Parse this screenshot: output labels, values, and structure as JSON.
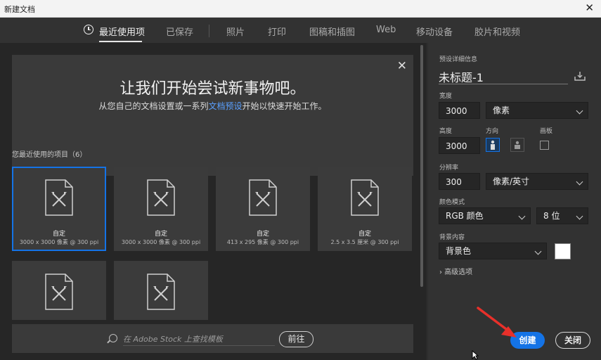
{
  "window": {
    "title": "新建文档",
    "close_glyph": "✕"
  },
  "tabs": [
    {
      "label": "最近使用项",
      "active": true,
      "icon": "clock-icon"
    },
    {
      "label": "已保存"
    },
    {
      "label": "照片"
    },
    {
      "label": "打印"
    },
    {
      "label": "图稿和插图"
    },
    {
      "label": "Web"
    },
    {
      "label": "移动设备"
    },
    {
      "label": "胶片和视频"
    }
  ],
  "banner": {
    "title": "让我们开始尝试新事物吧。",
    "subtitle_before": "从您自己的文档设置或一系列",
    "subtitle_link": "文档预设",
    "subtitle_after": "开始以快速开始工作。",
    "close_glyph": "✕"
  },
  "recent": {
    "label": "您最近使用的项目（6）",
    "items": [
      {
        "name": "自定",
        "size": "3000 x 3000 像素 @ 300 ppi"
      },
      {
        "name": "自定",
        "size": "3000 x 3000 像素 @ 300 ppi"
      },
      {
        "name": "自定",
        "size": "413 x 295 像素 @ 300 ppi"
      },
      {
        "name": "自定",
        "size": "2.5 x 3.5 厘米 @ 300 ppi"
      },
      {
        "name": "",
        "size": ""
      },
      {
        "name": "",
        "size": ""
      }
    ]
  },
  "search": {
    "placeholder": "在 Adobe Stock 上查找模板",
    "go_label": "前往"
  },
  "preset": {
    "section_label": "预设详细信息",
    "doc_name": "未标题-1",
    "width_label": "宽度",
    "width_value": "3000",
    "width_unit": "像素",
    "height_label": "高度",
    "height_value": "3000",
    "orientation_label": "方向",
    "artboard_label": "画板",
    "resolution_label": "分辨率",
    "resolution_value": "300",
    "resolution_unit": "像素/英寸",
    "color_mode_label": "颜色模式",
    "color_mode": "RGB 颜色",
    "bit_depth": "8 位",
    "background_label": "背景内容",
    "background": "背景色",
    "background_color": "#ffffff",
    "advanced_label": "高级选项"
  },
  "actions": {
    "create_label": "创建",
    "close_label": "关闭"
  },
  "colors": {
    "accent": "#1473e6",
    "arrow": "#e8302a"
  }
}
